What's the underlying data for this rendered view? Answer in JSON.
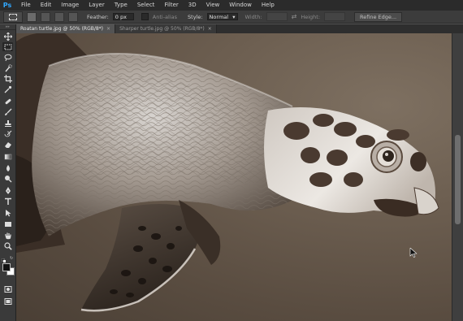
{
  "app": {
    "logo_text": "Ps"
  },
  "menu": [
    "File",
    "Edit",
    "Image",
    "Layer",
    "Type",
    "Select",
    "Filter",
    "3D",
    "View",
    "Window",
    "Help"
  ],
  "options": {
    "feather_label": "Feather:",
    "feather_value": "0 px",
    "antialias_label": "Anti-alias",
    "style_label": "Style:",
    "style_value": "Normal",
    "width_label": "Width:",
    "height_label": "Height:",
    "refine_label": "Refine Edge..."
  },
  "tabs": [
    {
      "label": "Roatan turtle.jpg @ 50% (RGB/8*)",
      "active": true
    },
    {
      "label": "Sharper turtle.jpg @ 50% (RGB/8*)",
      "active": false
    }
  ],
  "tools": [
    "move-tool-icon",
    "marquee-tool-icon",
    "lasso-tool-icon",
    "quick-select-icon",
    "crop-tool-icon",
    "eyedropper-icon",
    "spot-heal-icon",
    "brush-tool-icon",
    "clone-stamp-icon",
    "history-brush-icon",
    "eraser-icon",
    "gradient-tool-icon",
    "blur-tool-icon",
    "dodge-tool-icon",
    "pen-tool-icon",
    "type-tool-icon",
    "path-select-icon",
    "rectangle-tool-icon",
    "hand-tool-icon",
    "zoom-tool-icon"
  ],
  "colors": {
    "foreground": "#111111",
    "background": "#ffffff",
    "accent": "#31a8ff"
  }
}
